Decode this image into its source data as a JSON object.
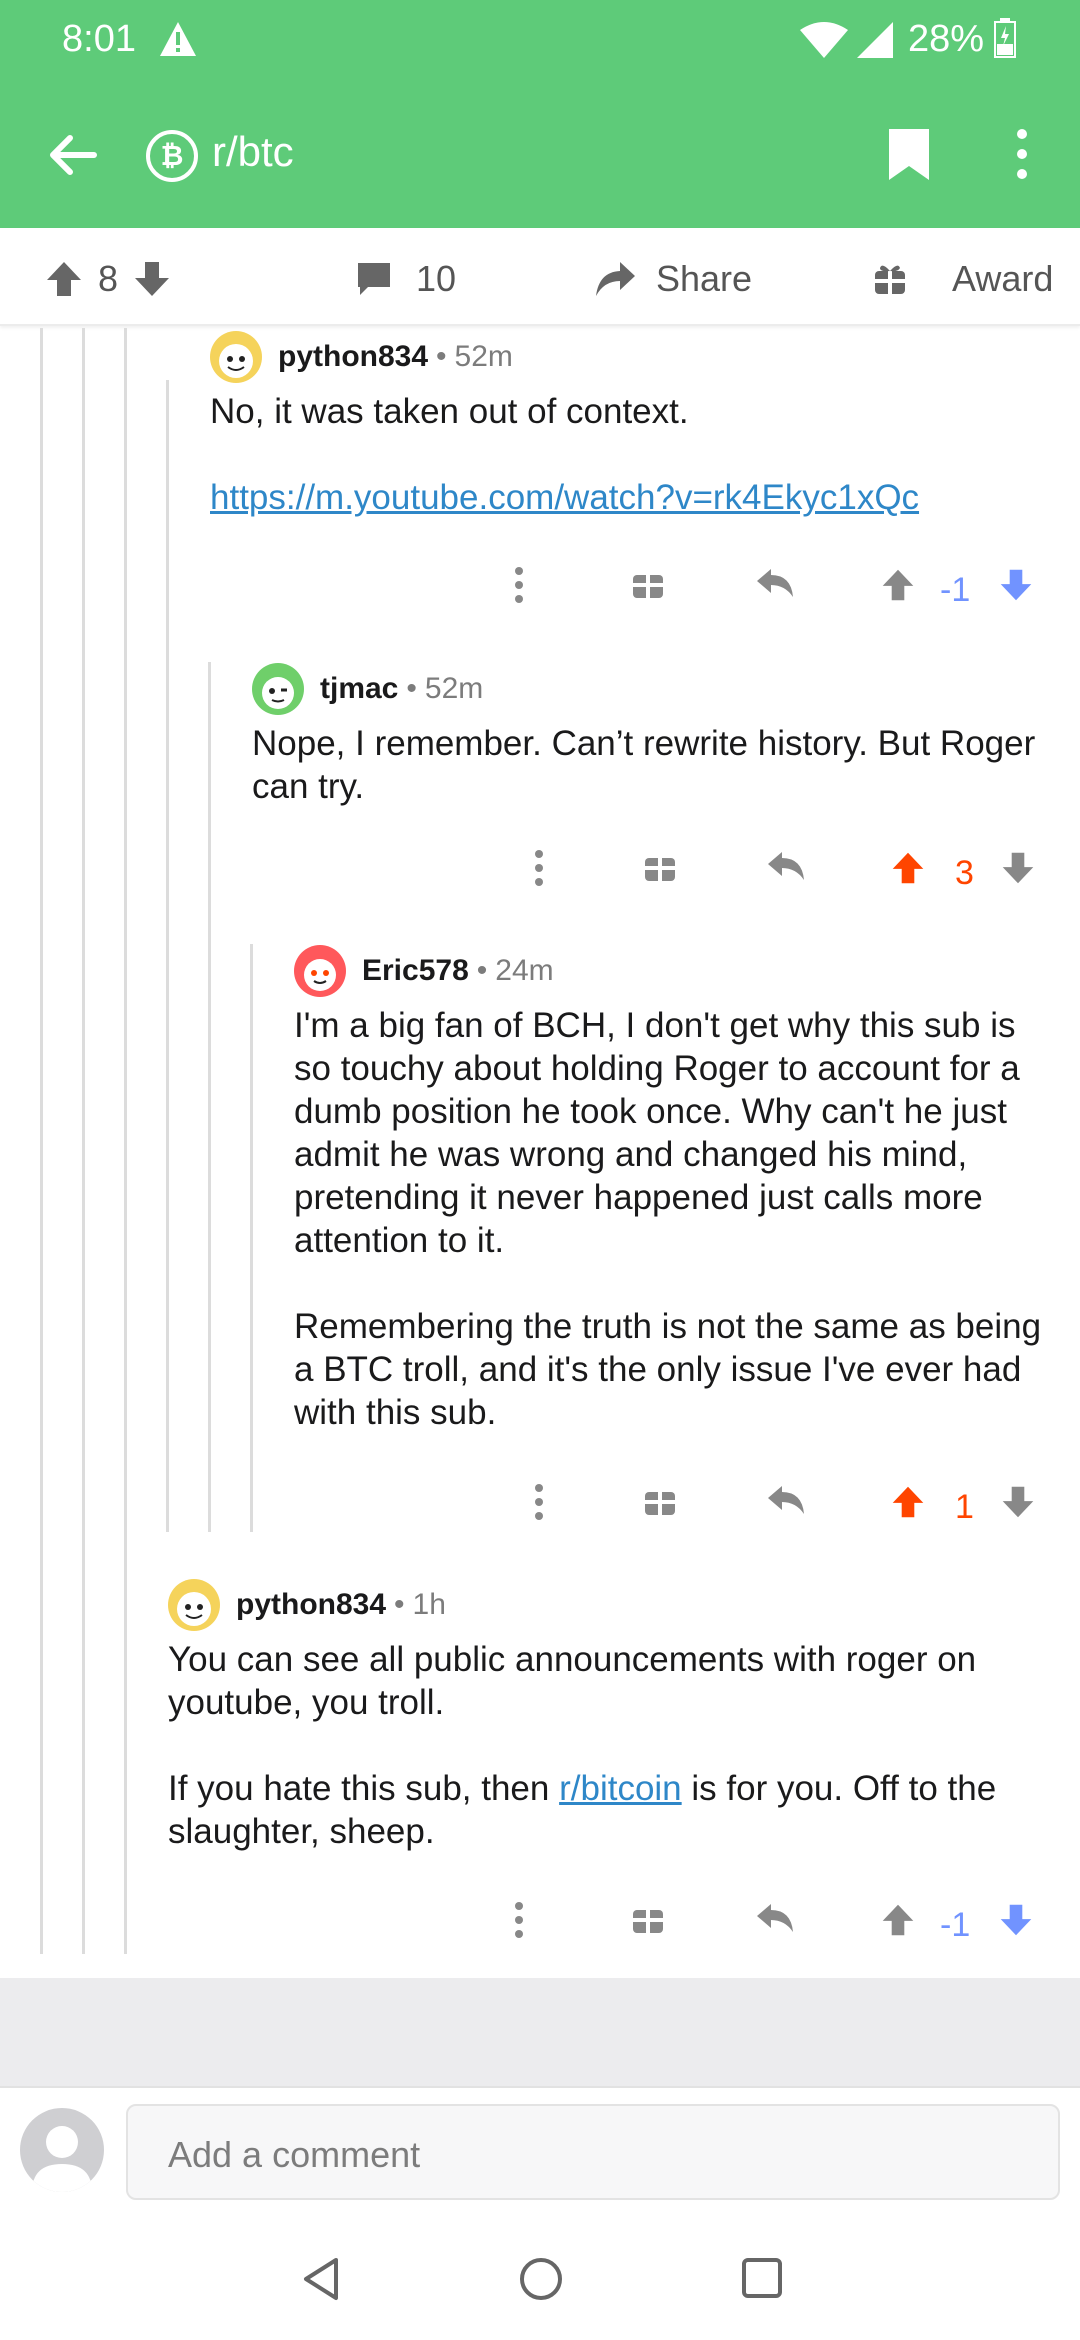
{
  "status_bar": {
    "time": "8:01",
    "battery": "28%"
  },
  "toolbar": {
    "subreddit": "r/btc",
    "sub_icon_glyph": "₿"
  },
  "post_actions": {
    "vote_count": "8",
    "comments_count": "10",
    "share_label": "Share",
    "award_label": "Award"
  },
  "comments": [
    {
      "user": "python834",
      "age": "52m",
      "body": [
        "No, it was taken out of context."
      ],
      "link": "https://m.youtube.com/watch?v=rk4Ekyc1xQc",
      "score": "-1",
      "vote_state": "downvoted"
    },
    {
      "user": "tjmac",
      "age": "52m",
      "body": [
        "Nope, I remember. Can’t rewrite history. But Roger can try."
      ],
      "score": "3",
      "vote_state": "upvoted"
    },
    {
      "user": "Eric578",
      "age": "24m",
      "body": [
        "I'm a big fan of BCH, I don't get why this sub is so touchy about holding Roger to account for a dumb position he took once.  Why can't he just admit he was wrong and changed his mind, pretending it never happened just calls more attention to it.",
        "Remembering the truth is not the same as being a BTC troll, and it's the only issue I've ever had with this sub."
      ],
      "score": "1",
      "vote_state": "upvoted"
    },
    {
      "user": "python834",
      "age": "1h",
      "body_p1": "You can see all public announcements with roger on youtube, you troll.",
      "body_p2_before": "If you hate this sub, then ",
      "body_p2_link": "r/bitcoin",
      "body_p2_after": " is for you. Off to the slaughter, sheep.",
      "score": "-1",
      "vote_state": "downvoted"
    }
  ],
  "composer": {
    "placeholder": "Add a comment"
  },
  "separator_dot": "•",
  "colors": {
    "app_bar": "#5ecb79",
    "upvote": "#ff4500",
    "downvote": "#7193ff",
    "link": "#2e87c8"
  },
  "icons": [
    "warning-icon",
    "wifi-icon",
    "signal-icon",
    "battery-icon",
    "back-arrow-icon",
    "bitcoin-icon",
    "bookmark-icon",
    "more-vert-icon",
    "upvote-icon",
    "downvote-icon",
    "comment-icon",
    "share-icon",
    "award-icon",
    "reply-icon",
    "nav-back-icon",
    "nav-home-icon",
    "nav-recents-icon"
  ]
}
